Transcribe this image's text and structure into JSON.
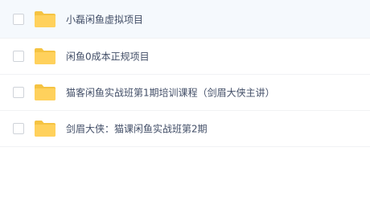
{
  "files": [
    {
      "name": "小磊闲鱼虚拟项目",
      "icon": "folder-icon",
      "selected": false
    },
    {
      "name": "闲鱼0成本正规项目",
      "icon": "folder-icon",
      "selected": false
    },
    {
      "name": "猫客闲鱼实战班第1期培训课程（剑眉大侠主讲）",
      "icon": "folder-icon",
      "selected": false
    },
    {
      "name": "剑眉大侠：猫课闲鱼实战班第2期",
      "icon": "folder-icon",
      "selected": false
    }
  ],
  "colors": {
    "folder": "#ffd15c",
    "folder_tab": "#f5c342",
    "row_highlight": "#f5f9fd",
    "text": "#424e67"
  }
}
